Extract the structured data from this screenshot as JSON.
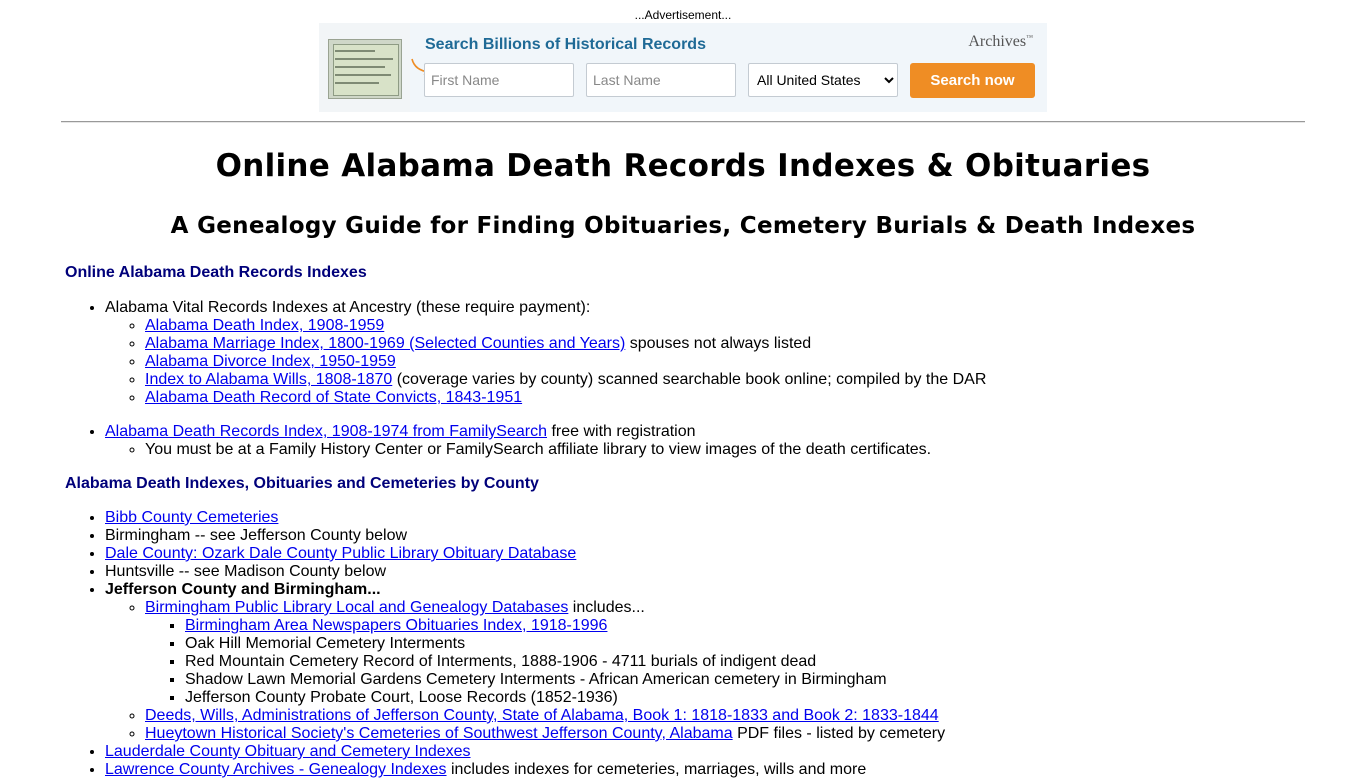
{
  "ad": {
    "label": "...Advertisement...",
    "title": "Search Billions of Historical Records",
    "brand": "Archives",
    "brand_tm": "™",
    "first_name_placeholder": "First Name",
    "last_name_placeholder": "Last Name",
    "location_selected": "All United States",
    "search_button": "Search now"
  },
  "heading": "Online Alabama Death Records Indexes & Obituaries",
  "subheading": "A Genealogy Guide for Finding Obituaries, Cemetery Burials & Death Indexes",
  "section1": {
    "title": "Online Alabama Death Records Indexes",
    "ancestry": {
      "label": "Alabama Vital Records Indexes at Ancestry (these require payment):",
      "links": [
        {
          "link": "Alabama Death Index, 1908-1959",
          "note": ""
        },
        {
          "link": "Alabama Marriage Index, 1800-1969 (Selected Counties and Years)",
          "note": " spouses not always listed"
        },
        {
          "link": "Alabama Divorce Index, 1950-1959",
          "note": ""
        },
        {
          "link": "Index to Alabama Wills, 1808-1870",
          "note": " (coverage varies by county) scanned searchable book online; compiled by the DAR"
        },
        {
          "link": "Alabama Death Record of State Convicts, 1843-1951",
          "note": ""
        }
      ]
    },
    "familysearch": {
      "link": "Alabama Death Records Index, 1908-1974 from FamilySearch",
      "note": " free with registration",
      "sub": "You must be at a Family History Center or FamilySearch affiliate library to view images of the death certificates."
    }
  },
  "section2": {
    "title": "Alabama Death Indexes, Obituaries and Cemeteries by County",
    "bibb": "Bibb County Cemeteries",
    "birmingham": "Birmingham -- see Jefferson County below",
    "dale": "Dale County: Ozark Dale County Public Library Obituary Database",
    "huntsville": "Huntsville -- see Madison County below",
    "jefferson": {
      "label": "Jefferson County and Birmingham...",
      "bpl": {
        "link": "Birmingham Public Library Local and Genealogy Databases",
        "note": " includes...",
        "items": [
          "Oak Hill Memorial Cemetery Interments",
          "Red Mountain Cemetery Record of Interments, 1888-1906 - 4711 burials of indigent dead",
          "Shadow Lawn Memorial Gardens Cemetery Interments - African American cemetery in Birmingham",
          "Jefferson County Probate Court, Loose Records (1852-1936)"
        ],
        "first_link": "Birmingham Area Newspapers Obituaries Index, 1918-1996"
      },
      "deeds": "Deeds, Wills, Administrations of Jefferson County, State of Alabama, Book 1: 1818-1833 and Book 2: 1833-1844",
      "hueytown": {
        "link": "Hueytown Historical Society's Cemeteries of Southwest Jefferson County, Alabama",
        "note": " PDF files - listed by cemetery"
      }
    },
    "lauderdale": "Lauderdale County Obituary and Cemetery Indexes",
    "lawrence": {
      "link": "Lawrence County Archives - Genealogy Indexes",
      "note": " includes indexes for cemeteries, marriages, wills and more"
    }
  }
}
